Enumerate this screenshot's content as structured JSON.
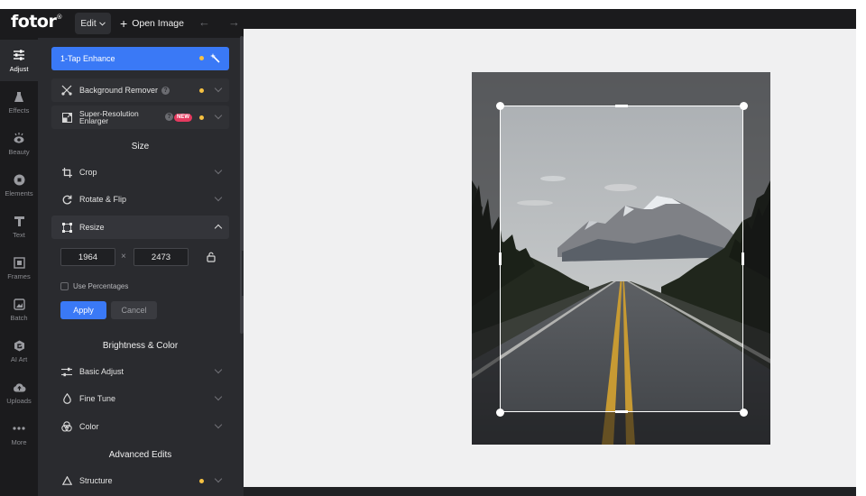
{
  "app": {
    "logo": "fotor",
    "logo_mark": "®",
    "edit_label": "Edit",
    "open_image_label": "Open Image"
  },
  "rail": [
    {
      "label": "Adjust",
      "icon": "sliders-icon",
      "active": true
    },
    {
      "label": "Effects",
      "icon": "flask-icon"
    },
    {
      "label": "Beauty",
      "icon": "eye-icon"
    },
    {
      "label": "Elements",
      "icon": "shapes-icon"
    },
    {
      "label": "Text",
      "icon": "text-icon"
    },
    {
      "label": "Frames",
      "icon": "frame-icon"
    },
    {
      "label": "Batch",
      "icon": "batch-icon"
    },
    {
      "label": "AI Art",
      "icon": "ai-art-icon"
    },
    {
      "label": "Uploads",
      "icon": "cloud-upload-icon"
    },
    {
      "label": "More",
      "icon": "more-icon"
    }
  ],
  "panel": {
    "enhance": "1-Tap Enhance",
    "background_remover": "Background Remover",
    "super_resolution": "Super-Resolution Enlarger",
    "new_badge": "NEW",
    "size_heading": "Size",
    "crop": "Crop",
    "rotate_flip": "Rotate & Flip",
    "resize": "Resize",
    "resize_width": "1964",
    "resize_height": "2473",
    "times": "×",
    "use_percentages": "Use Percentages",
    "apply": "Apply",
    "cancel": "Cancel",
    "brightness_heading": "Brightness & Color",
    "basic_adjust": "Basic Adjust",
    "fine_tune": "Fine Tune",
    "color": "Color",
    "advanced_heading": "Advanced Edits",
    "structure": "Structure"
  },
  "colors": {
    "accent": "#3a79f6",
    "dot": "#f6c142",
    "badge": "#e53a5f"
  }
}
